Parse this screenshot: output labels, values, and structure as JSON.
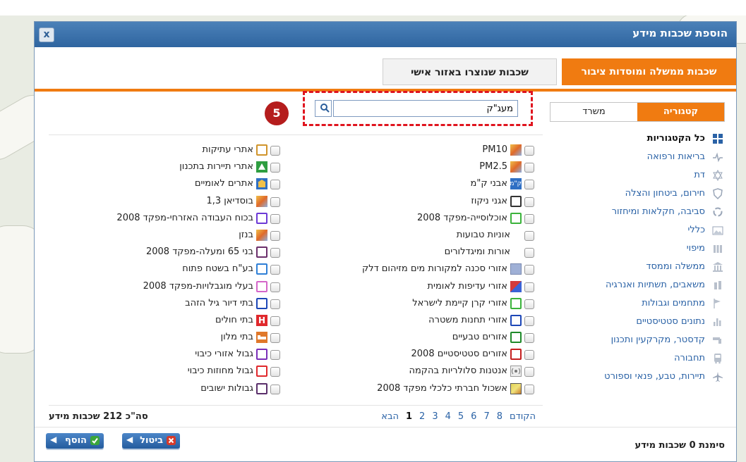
{
  "header_snippet": "",
  "dialog": {
    "title": "הוספת שכבות מידע",
    "close_label": "x"
  },
  "tabs": [
    {
      "label": "שכבות ממשלה ומוסדות ציבור",
      "active": true
    },
    {
      "label": "שכבות שנוצרו באזור אישי",
      "active": false
    }
  ],
  "side_toggle": {
    "category": "קטגוריה",
    "office": "משרד"
  },
  "categories": [
    {
      "label": "כל הקטגוריות",
      "icon": "grid-icon",
      "active": true
    },
    {
      "label": "בריאות ורפואה",
      "icon": "heartbeat-icon"
    },
    {
      "label": "דת",
      "icon": "star-of-david-icon"
    },
    {
      "label": "חירום, ביטחון והצלה",
      "icon": "shield-icon"
    },
    {
      "label": "סביבה, חקלאות ומיחזור",
      "icon": "recycle-icon"
    },
    {
      "label": "כללי",
      "icon": "image-icon"
    },
    {
      "label": "מיפוי",
      "icon": "map-bars-icon"
    },
    {
      "label": "ממשלה וממסד",
      "icon": "government-building-icon"
    },
    {
      "label": "משאבים, תשתיות ואנרגיה",
      "icon": "resources-icon"
    },
    {
      "label": "מתחמים וגבולות",
      "icon": "flag-icon"
    },
    {
      "label": "נתונים סטטיסטיים",
      "icon": "bar-chart-icon"
    },
    {
      "label": "קדסטר, מקרקעין ותכנון",
      "icon": "faucet-icon"
    },
    {
      "label": "תחבורה",
      "icon": "bus-icon"
    },
    {
      "label": "תיירות, טבע, פנאי וספורט",
      "icon": "airplane-icon"
    }
  ],
  "search": {
    "value": "מעג\"ק",
    "placeholder": ""
  },
  "step_badge": "5",
  "layers_right": [
    {
      "label": "PM10",
      "symbol": "gradient-orange",
      "color": "#e2a13a"
    },
    {
      "label": "PM2.5",
      "symbol": "gradient-orange",
      "color": "#e2a13a"
    },
    {
      "label": "אבני ק\"מ",
      "symbol": "text-badge",
      "color": "#2f6fc4"
    },
    {
      "label": "אגני ניקוז",
      "symbol": "outline",
      "color": "#333333"
    },
    {
      "label": "אוכלוסייה-מפקד 2008",
      "symbol": "outline",
      "color": "#3bb33b"
    },
    {
      "label": "אוניות טבועות",
      "symbol": "none",
      "color": ""
    },
    {
      "label": "אורות ומיגדלורים",
      "symbol": "none",
      "color": ""
    },
    {
      "label": "אזורי סכנה למקורות מים מזיהום דלק",
      "symbol": "fill",
      "color": "#9fb0d6"
    },
    {
      "label": "אזורי עדיפות לאומית",
      "symbol": "split-red-blue",
      "color": "#d23b3b"
    },
    {
      "label": "אזורי קרן קיימת לישראל",
      "symbol": "outline",
      "color": "#3bb33b"
    },
    {
      "label": "אזורי תחנות משטרה",
      "symbol": "outline",
      "color": "#1d47b7"
    },
    {
      "label": "אזורים טבעיים",
      "symbol": "outline",
      "color": "#1f8a2a"
    },
    {
      "label": "אזורים סטטיסטיים 2008",
      "symbol": "outline",
      "color": "#c41f1f"
    },
    {
      "label": "אנטנות סלולריות בהקמה",
      "symbol": "antenna",
      "color": "#8a8a8a"
    },
    {
      "label": "אשכול חברתי כלכלי מפקד 2008",
      "symbol": "gradient-yellow",
      "color": "#e8d44a"
    }
  ],
  "layers_left": [
    {
      "label": "אתרי עתיקות",
      "symbol": "outline",
      "color": "#d0942b"
    },
    {
      "label": "אתרי תיירות בתכנון",
      "symbol": "icon-green",
      "color": "#2f9e41"
    },
    {
      "label": "אתרים לאומיים",
      "symbol": "icon-blue",
      "color": "#2f6fc4"
    },
    {
      "label": "בוסדיאן 1,3",
      "symbol": "gradient-orange",
      "color": "#e2a13a"
    },
    {
      "label": "בכוח העבודה האזרחי-מפקד 2008",
      "symbol": "outline",
      "color": "#6d3ad6"
    },
    {
      "label": "בנזן",
      "symbol": "gradient-orange",
      "color": "#e2a13a"
    },
    {
      "label": "בני 65 ומעלה-מפקד 2008",
      "symbol": "outline",
      "color": "#6b2f6b"
    },
    {
      "label": "בע\"ח בשטח פתוח",
      "symbol": "outline",
      "color": "#2f7fd6"
    },
    {
      "label": "בעלי מוגבלויות-מפקד 2008",
      "symbol": "outline",
      "color": "#d466c9"
    },
    {
      "label": "בתי דיור גיל הזהב",
      "symbol": "outline",
      "color": "#1d47b7"
    },
    {
      "label": "בתי חולים",
      "symbol": "hospital",
      "color": "#e0282c"
    },
    {
      "label": "בתי מלון",
      "symbol": "hotel",
      "color": "#e0782a"
    },
    {
      "label": "גבול אזורי כיבוי",
      "symbol": "outline",
      "color": "#7b2fb8"
    },
    {
      "label": "גבול מחוזות כיבוי",
      "symbol": "outline",
      "color": "#e0282c"
    },
    {
      "label": "גבולות ישובים",
      "symbol": "outline",
      "color": "#5a2f6b"
    }
  ],
  "pager": {
    "prev": "הקודם",
    "pages": [
      "1",
      "2",
      "3",
      "4",
      "5",
      "6",
      "7",
      "8"
    ],
    "current": "1",
    "next": "הבא"
  },
  "total": "סה\"כ 212 שכבות מידע",
  "selected": "סימנת 0 שכבות מידע",
  "buttons": {
    "add": "הוסף",
    "cancel": "ביטול"
  },
  "colors": {
    "accent": "#f07b11",
    "title_bar": "#2f65a0",
    "link": "#2a62a6",
    "highlight": "#e0141e"
  }
}
